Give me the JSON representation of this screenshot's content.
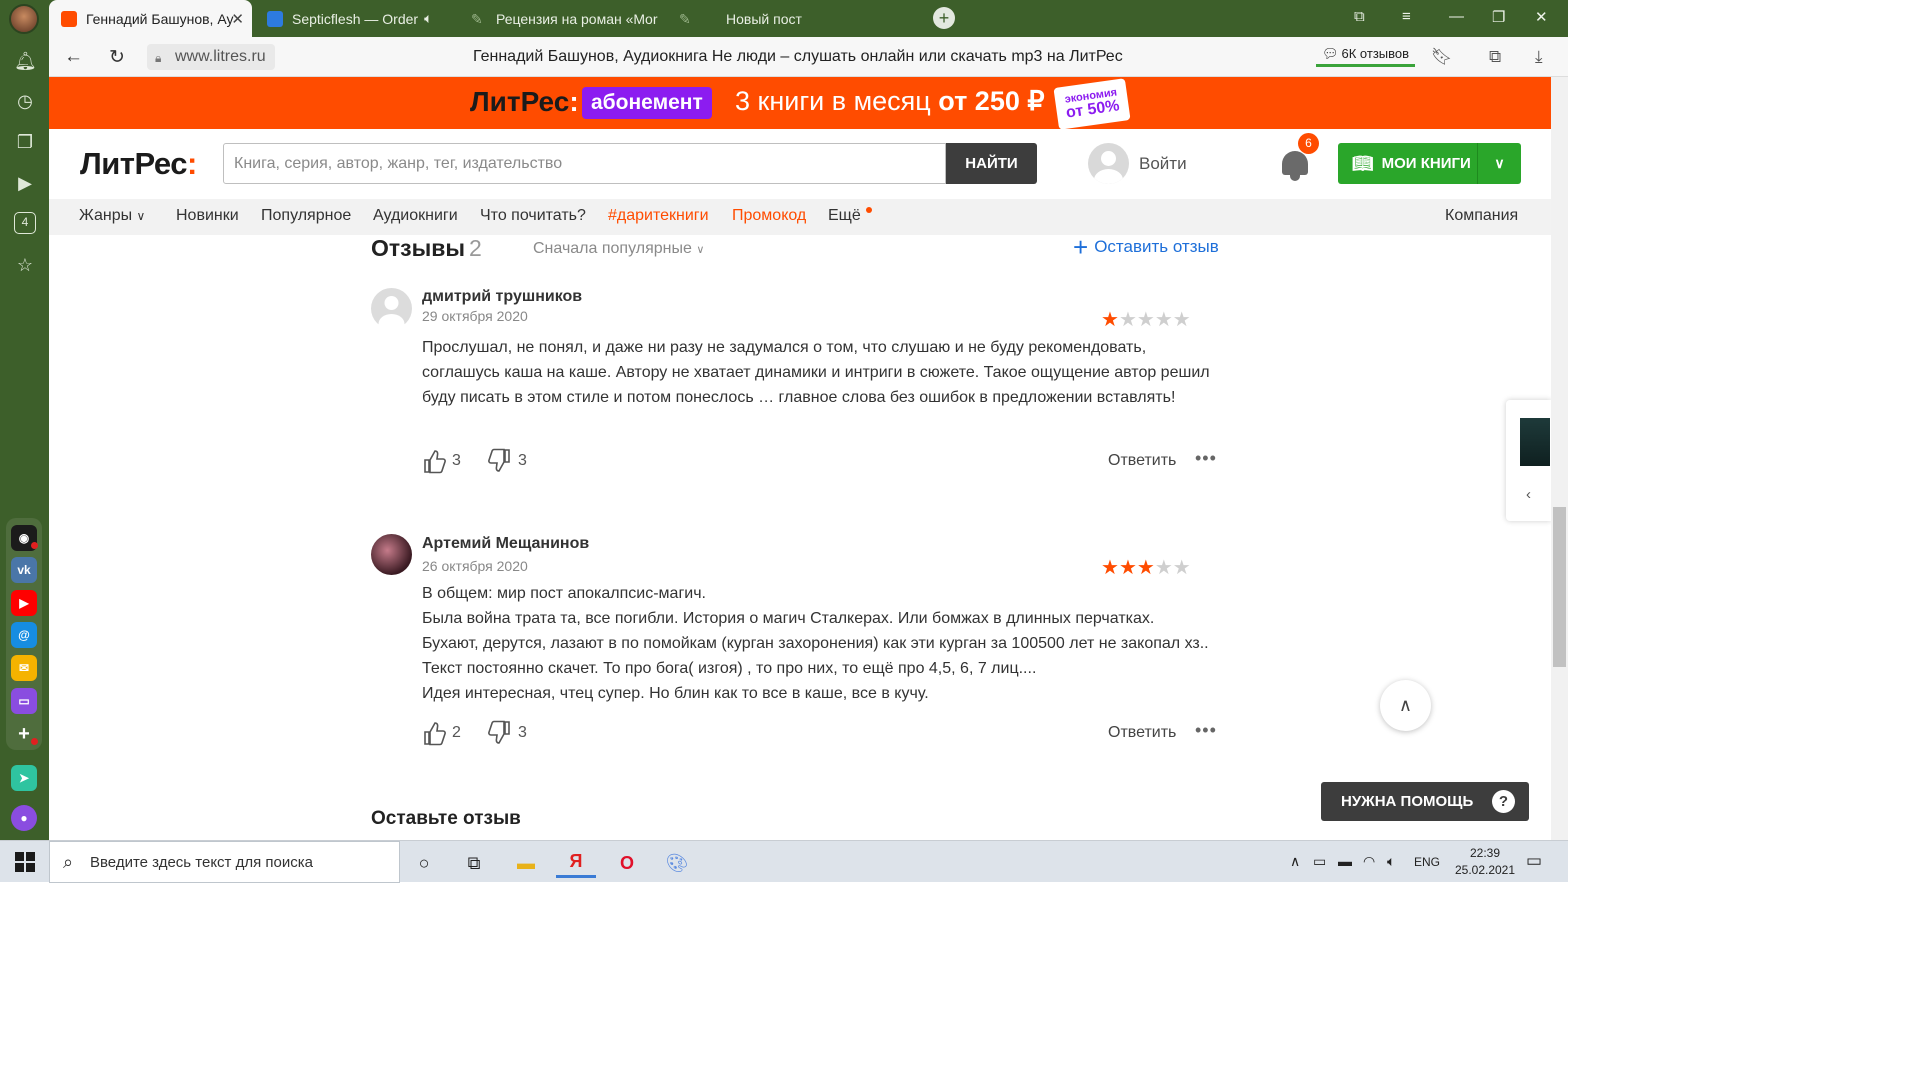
{
  "browser": {
    "tabs": [
      {
        "title": "Геннадий Башунов, Ау",
        "active": true
      },
      {
        "title": "Septicflesh — Order",
        "active": false
      },
      {
        "title": "Рецензия на роман «Mor",
        "active": false
      },
      {
        "title": "Новый пост",
        "active": false
      }
    ],
    "url": "www.litres.ru",
    "page_title": "Геннадий Башунов, Аудиокнига Не люди – слушать онлайн или скачать mp3 на ЛитРес",
    "reviews_pill": "6К отзывов",
    "sidebar_badge": "4"
  },
  "promo": {
    "logo_main": "ЛитРес",
    "logo_colon": ":",
    "subscription": "абонемент",
    "offer_text": "3 книги в месяц ",
    "offer_price": "от 250 ₽",
    "sticker_top": "экономия",
    "sticker_bottom": "от 50%"
  },
  "header": {
    "logo_main": "ЛитРес",
    "logo_colon": ":",
    "search_placeholder": "Книга, серия, автор, жанр, тег, издательство",
    "search_button": "НАЙТИ",
    "login": "Войти",
    "notifications_count": "6",
    "my_books": "МОИ КНИГИ"
  },
  "menu": {
    "items": [
      "Жанры",
      "Новинки",
      "Популярное",
      "Аудиокниги",
      "Что почитать?",
      "#даритекниги",
      "Промокод",
      "Ещё"
    ],
    "company": "Компания"
  },
  "reviews": {
    "heading": "Отзывы",
    "count": "2",
    "sort": "Сначала популярные",
    "leave_review": "Оставить отзыв",
    "items": [
      {
        "author": "дмитрий трушников",
        "date": "29 октября 2020",
        "rating": 1,
        "text": "Прослушал, не понял, и даже ни разу не задумался о том, что слушаю и не буду рекомендовать, соглашусь каша на каше. Автору не хватает динамики и интриги в сюжете. Такое ощущение автор решил буду писать в этом стиле и потом понеслось … главное слова без ошибок в предложении вставлять!",
        "likes": "3",
        "dislikes": "3",
        "reply": "Ответить"
      },
      {
        "author": "Артемий Мещанинов",
        "date": "26 октября 2020",
        "rating": 3,
        "text_lines": [
          "В общем: мир пост апокалпсис-магич.",
          "Была война трата та, все погибли. История о магич Сталкерах. Или бомжах в длинных перчатках.",
          "Бухают, дерутся, лазают в по помойкам (курган захоронения) как эти курган за 100500 лет не закопал хз.. Текст постоянно скачет. То про бога( изгоя) , то про них, то ещё про 4,5, 6, 7 лиц....",
          "Идея интересная, чтец супер. Но блин как то все в каше, все в кучу."
        ],
        "likes": "2",
        "dislikes": "3",
        "reply": "Ответить"
      }
    ]
  },
  "leave_heading": "Оставьте отзыв",
  "help_button": "НУЖНА ПОМОЩЬ",
  "taskbar": {
    "search_placeholder": "Введите здесь текст для поиска",
    "lang": "ENG",
    "time": "22:39",
    "date": "25.02.2021"
  }
}
